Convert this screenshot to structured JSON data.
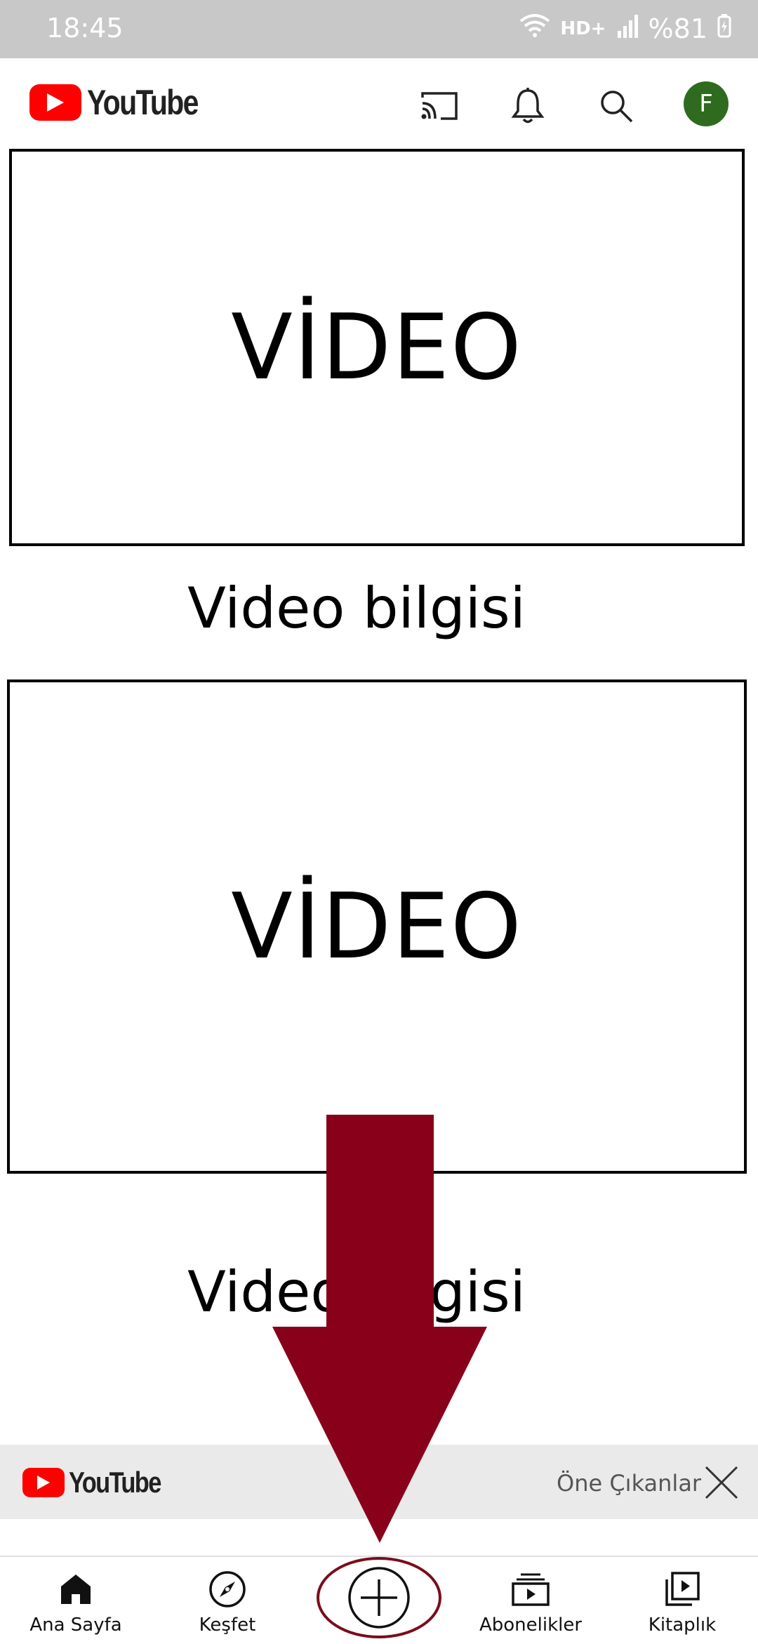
{
  "status_bar": {
    "time": "18:45",
    "network": "HD+",
    "battery": "%81"
  },
  "header": {
    "logo_text": "YouTube",
    "avatar_initial": "F"
  },
  "feed": [
    {
      "thumbnail_text": "VİDEO",
      "info": "Video bilgisi"
    },
    {
      "thumbnail_text": "VİDEO",
      "info": "Video bilgisi"
    }
  ],
  "featured_bar": {
    "logo_text": "YouTube",
    "label": "Öne Çıkanlar"
  },
  "bottom_nav": {
    "items": [
      {
        "label": "Ana Sayfa",
        "icon": "home-icon"
      },
      {
        "label": "Keşfet",
        "icon": "compass-icon"
      },
      {
        "label": "",
        "icon": "create-plus-icon"
      },
      {
        "label": "Abonelikler",
        "icon": "subscriptions-icon"
      },
      {
        "label": "Kitaplık",
        "icon": "library-icon"
      }
    ]
  },
  "colors": {
    "brand_red": "#ff0000",
    "arrow": "#880019",
    "avatar_bg": "#2e6b1e",
    "status_bar_bg": "#c8c8c8"
  }
}
